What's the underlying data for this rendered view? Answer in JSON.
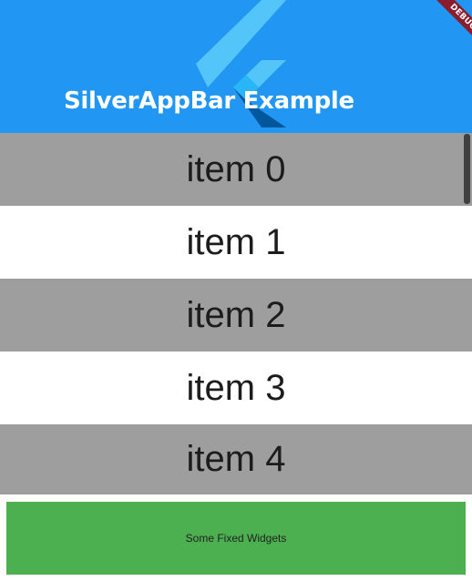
{
  "app_bar": {
    "title": "SilverAppBar Example",
    "background_color": "#2196f3",
    "logo_icon": "flutter-logo-icon",
    "debug_banner_label": "DEBUG"
  },
  "list": {
    "items": [
      {
        "label": "item 0"
      },
      {
        "label": "item 1"
      },
      {
        "label": "item 2"
      },
      {
        "label": "item 3"
      },
      {
        "label": "item 4"
      }
    ],
    "even_color": "#9e9e9e",
    "odd_color": "#ffffff"
  },
  "fixed_widget": {
    "label": "Some Fixed Widgets",
    "background_color": "#4caf50"
  }
}
